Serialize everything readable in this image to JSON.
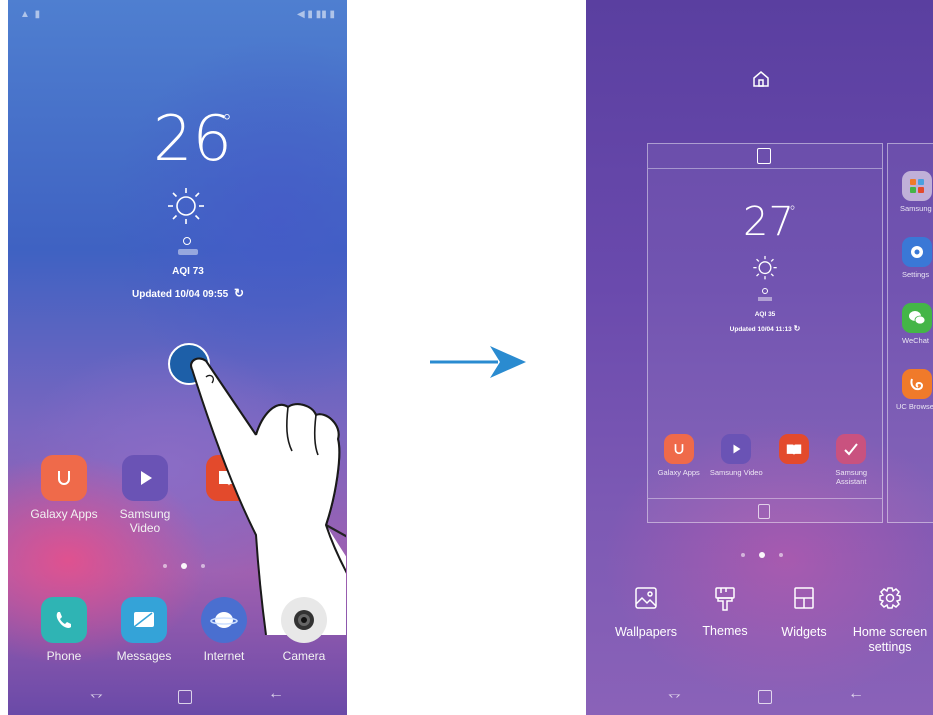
{
  "left_phone": {
    "weather": {
      "temperature": "26",
      "degree": "°",
      "aqi": "AQI 73",
      "updated": "Updated 10/04 09:55"
    },
    "apps_row": [
      {
        "label": "Galaxy Apps",
        "icon": "galaxy-apps-icon",
        "color": "#ef6a4a"
      },
      {
        "label": "Samsung Video",
        "icon": "samsung-video-icon",
        "color": "#6a53b5"
      },
      {
        "label": "",
        "icon": "samsung-books-icon",
        "color": "#e34a2c"
      }
    ],
    "dock": [
      {
        "label": "Phone",
        "icon": "phone-icon",
        "color": "#2fb4b4"
      },
      {
        "label": "Messages",
        "icon": "messages-icon",
        "color": "#34a3d8"
      },
      {
        "label": "Internet",
        "icon": "internet-icon",
        "color": "#4a6fd0"
      },
      {
        "label": "Camera",
        "icon": "camera-icon",
        "color": "#e8e8e8"
      }
    ]
  },
  "right_phone": {
    "weather": {
      "temperature": "27",
      "degree": "°",
      "aqi": "AQI 35",
      "updated": "Updated 10/04 11:13"
    },
    "apps_row": [
      {
        "label": "Galaxy Apps",
        "icon": "galaxy-apps-icon",
        "color": "#ef6a4a"
      },
      {
        "label": "Samsung Video",
        "icon": "samsung-video-icon",
        "color": "#6a53b5"
      },
      {
        "label": "",
        "icon": "samsung-books-icon",
        "color": "#e34a2c"
      },
      {
        "label": "Samsung Assistant",
        "icon": "samsung-assistant-icon",
        "color": "#c9527f"
      }
    ],
    "side_apps": [
      {
        "label": "Samsung",
        "icon": "samsung-folder-icon",
        "color": "#c0b0d8"
      },
      {
        "label": "Settings",
        "icon": "settings-icon",
        "color": "#3a78d6"
      },
      {
        "label": "WeChat",
        "icon": "wechat-icon",
        "color": "#44b547"
      },
      {
        "label": "UC Browse",
        "icon": "uc-browser-icon",
        "color": "#f07a2a"
      }
    ],
    "menu": [
      {
        "label": "Wallpapers",
        "icon": "wallpapers-icon"
      },
      {
        "label": "Themes",
        "icon": "themes-icon"
      },
      {
        "label": "Widgets",
        "icon": "widgets-icon"
      },
      {
        "label": "Home screen settings",
        "icon": "home-settings-icon"
      }
    ]
  },
  "colors": {
    "arrow": "#2a8bd0",
    "touch_dot": "#1d5fa8"
  }
}
